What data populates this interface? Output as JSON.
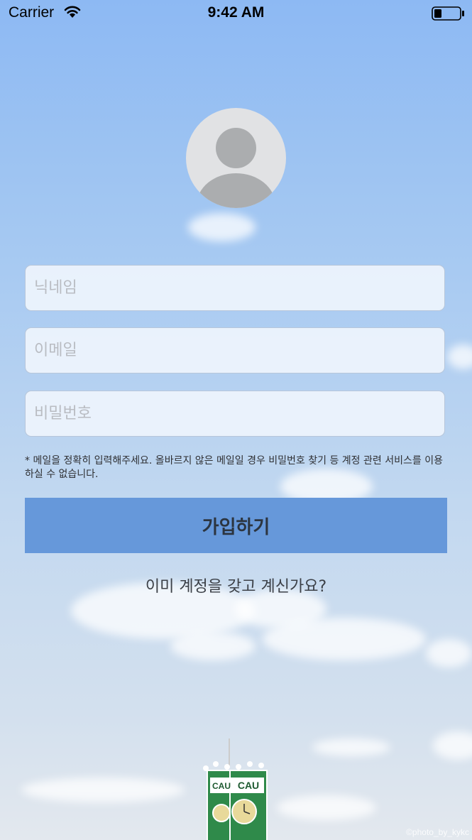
{
  "status_bar": {
    "carrier": "Carrier",
    "time": "9:42 AM"
  },
  "form": {
    "nickname_placeholder": "닉네임",
    "email_placeholder": "이메일",
    "password_placeholder": "비밀번호",
    "notice": "* 메일을 정확히 입력해주세요. 올바르지 않은 메일일 경우 비밀번호 찾기 등 계정 관련 서비스를 이용하실 수 없습니다.",
    "signup_label": "가입하기",
    "login_link": "이미 계정을 갖고 계신가요?"
  },
  "background": {
    "logo_text": "CAU",
    "photo_credit": "©photo_by_kykc"
  },
  "colors": {
    "button": "#6698da",
    "sky_top": "#8db9f3",
    "field_bg": "#eef4fd"
  }
}
